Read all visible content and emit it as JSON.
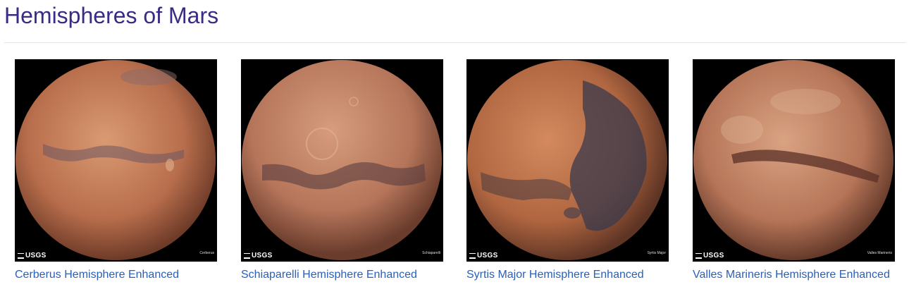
{
  "page": {
    "title": "Hemispheres of Mars"
  },
  "colors": {
    "title": "#3b2a86",
    "link": "#2a5fb8",
    "divider": "#e6e6e6",
    "thumb_bg": "#000000"
  },
  "hemispheres": [
    {
      "caption": "Cerberus Hemisphere Enhanced",
      "credit_logo": "USGS",
      "credit_name": "Cerberus",
      "palette": [
        "#c98660",
        "#a86447",
        "#7a4f52"
      ]
    },
    {
      "caption": "Schiaparelli Hemisphere Enhanced",
      "credit_logo": "USGS",
      "credit_name": "Schiaparelli",
      "palette": [
        "#c48a6a",
        "#a2644d",
        "#5b3e3e"
      ]
    },
    {
      "caption": "Syrtis Major Hemisphere Enhanced",
      "credit_logo": "USGS",
      "credit_name": "Syrtis Major",
      "palette": [
        "#c47a52",
        "#a25a3c",
        "#3c3a4a"
      ]
    },
    {
      "caption": "Valles Marineris Hemisphere Enhanced",
      "credit_logo": "USGS",
      "credit_name": "Valles Marineris",
      "palette": [
        "#c99070",
        "#a1634a",
        "#6a3d33"
      ]
    }
  ]
}
